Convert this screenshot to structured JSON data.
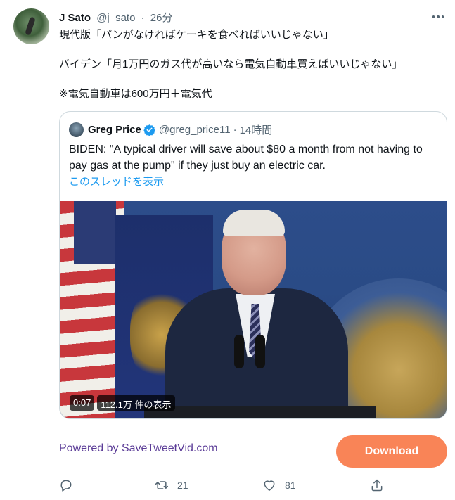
{
  "tweet": {
    "author_name": "J Sato",
    "author_handle": "@j_sato",
    "separator": "·",
    "time": "26分",
    "lines": [
      "現代版「パンがなければケーキを食べればいいじゃない」",
      "バイデン「月1万円のガス代が高いなら電気自動車買えばいいじゃない」",
      "※電気自動車は600万円＋電気代"
    ]
  },
  "quote": {
    "author_name": "Greg Price",
    "author_handle": "@greg_price11",
    "separator": "·",
    "time": "14時間",
    "text": "BIDEN: \"A typical driver will save about $80 a month from not having to pay gas at the pump\" if they just buy an electric car.",
    "thread_link": "このスレッドを表示",
    "video": {
      "duration": "0:07",
      "views": "112.1万 件の表示"
    }
  },
  "footer": {
    "powered_by": "Powered by SaveTweetVid.com",
    "download_label": "Download"
  },
  "actions": {
    "reply_count": "",
    "retweet_count": "21",
    "like_count": "81"
  },
  "icons": {
    "more": "more-dots-icon",
    "verified": "verified-badge-icon",
    "reply": "reply-icon",
    "retweet": "retweet-icon",
    "like": "like-heart-icon",
    "share": "share-icon"
  },
  "colors": {
    "link": "#1d9bf0",
    "download_button": "#f98457",
    "powered_text": "#5b3c97",
    "muted_text": "#536471"
  }
}
